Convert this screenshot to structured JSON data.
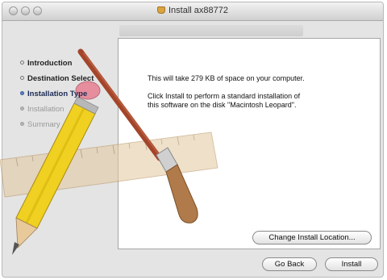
{
  "window": {
    "title": "Install ax88772"
  },
  "sidebar": {
    "steps": [
      {
        "label": "Introduction",
        "state": "done"
      },
      {
        "label": "Destination Select",
        "state": "done"
      },
      {
        "label": "Installation Type",
        "state": "current"
      },
      {
        "label": "Installation",
        "state": "pending"
      },
      {
        "label": "Summary",
        "state": "pending"
      }
    ]
  },
  "content": {
    "space_text": "This will take 279 KB of space on your computer.",
    "install_line1": "Click Install to perform a standard installation of",
    "install_line2": "this software on the disk \"Macintosh Leopard\"."
  },
  "buttons": {
    "change_location": "Change Install Location...",
    "go_back": "Go Back",
    "install": "Install"
  },
  "colors": {
    "current_step": "#5b7fc7",
    "window_bg": "#e4e4e4"
  },
  "icons": [
    "close-icon",
    "minimize-icon",
    "zoom-icon",
    "package-icon",
    "pencil-icon",
    "brush-icon",
    "ruler-icon"
  ]
}
